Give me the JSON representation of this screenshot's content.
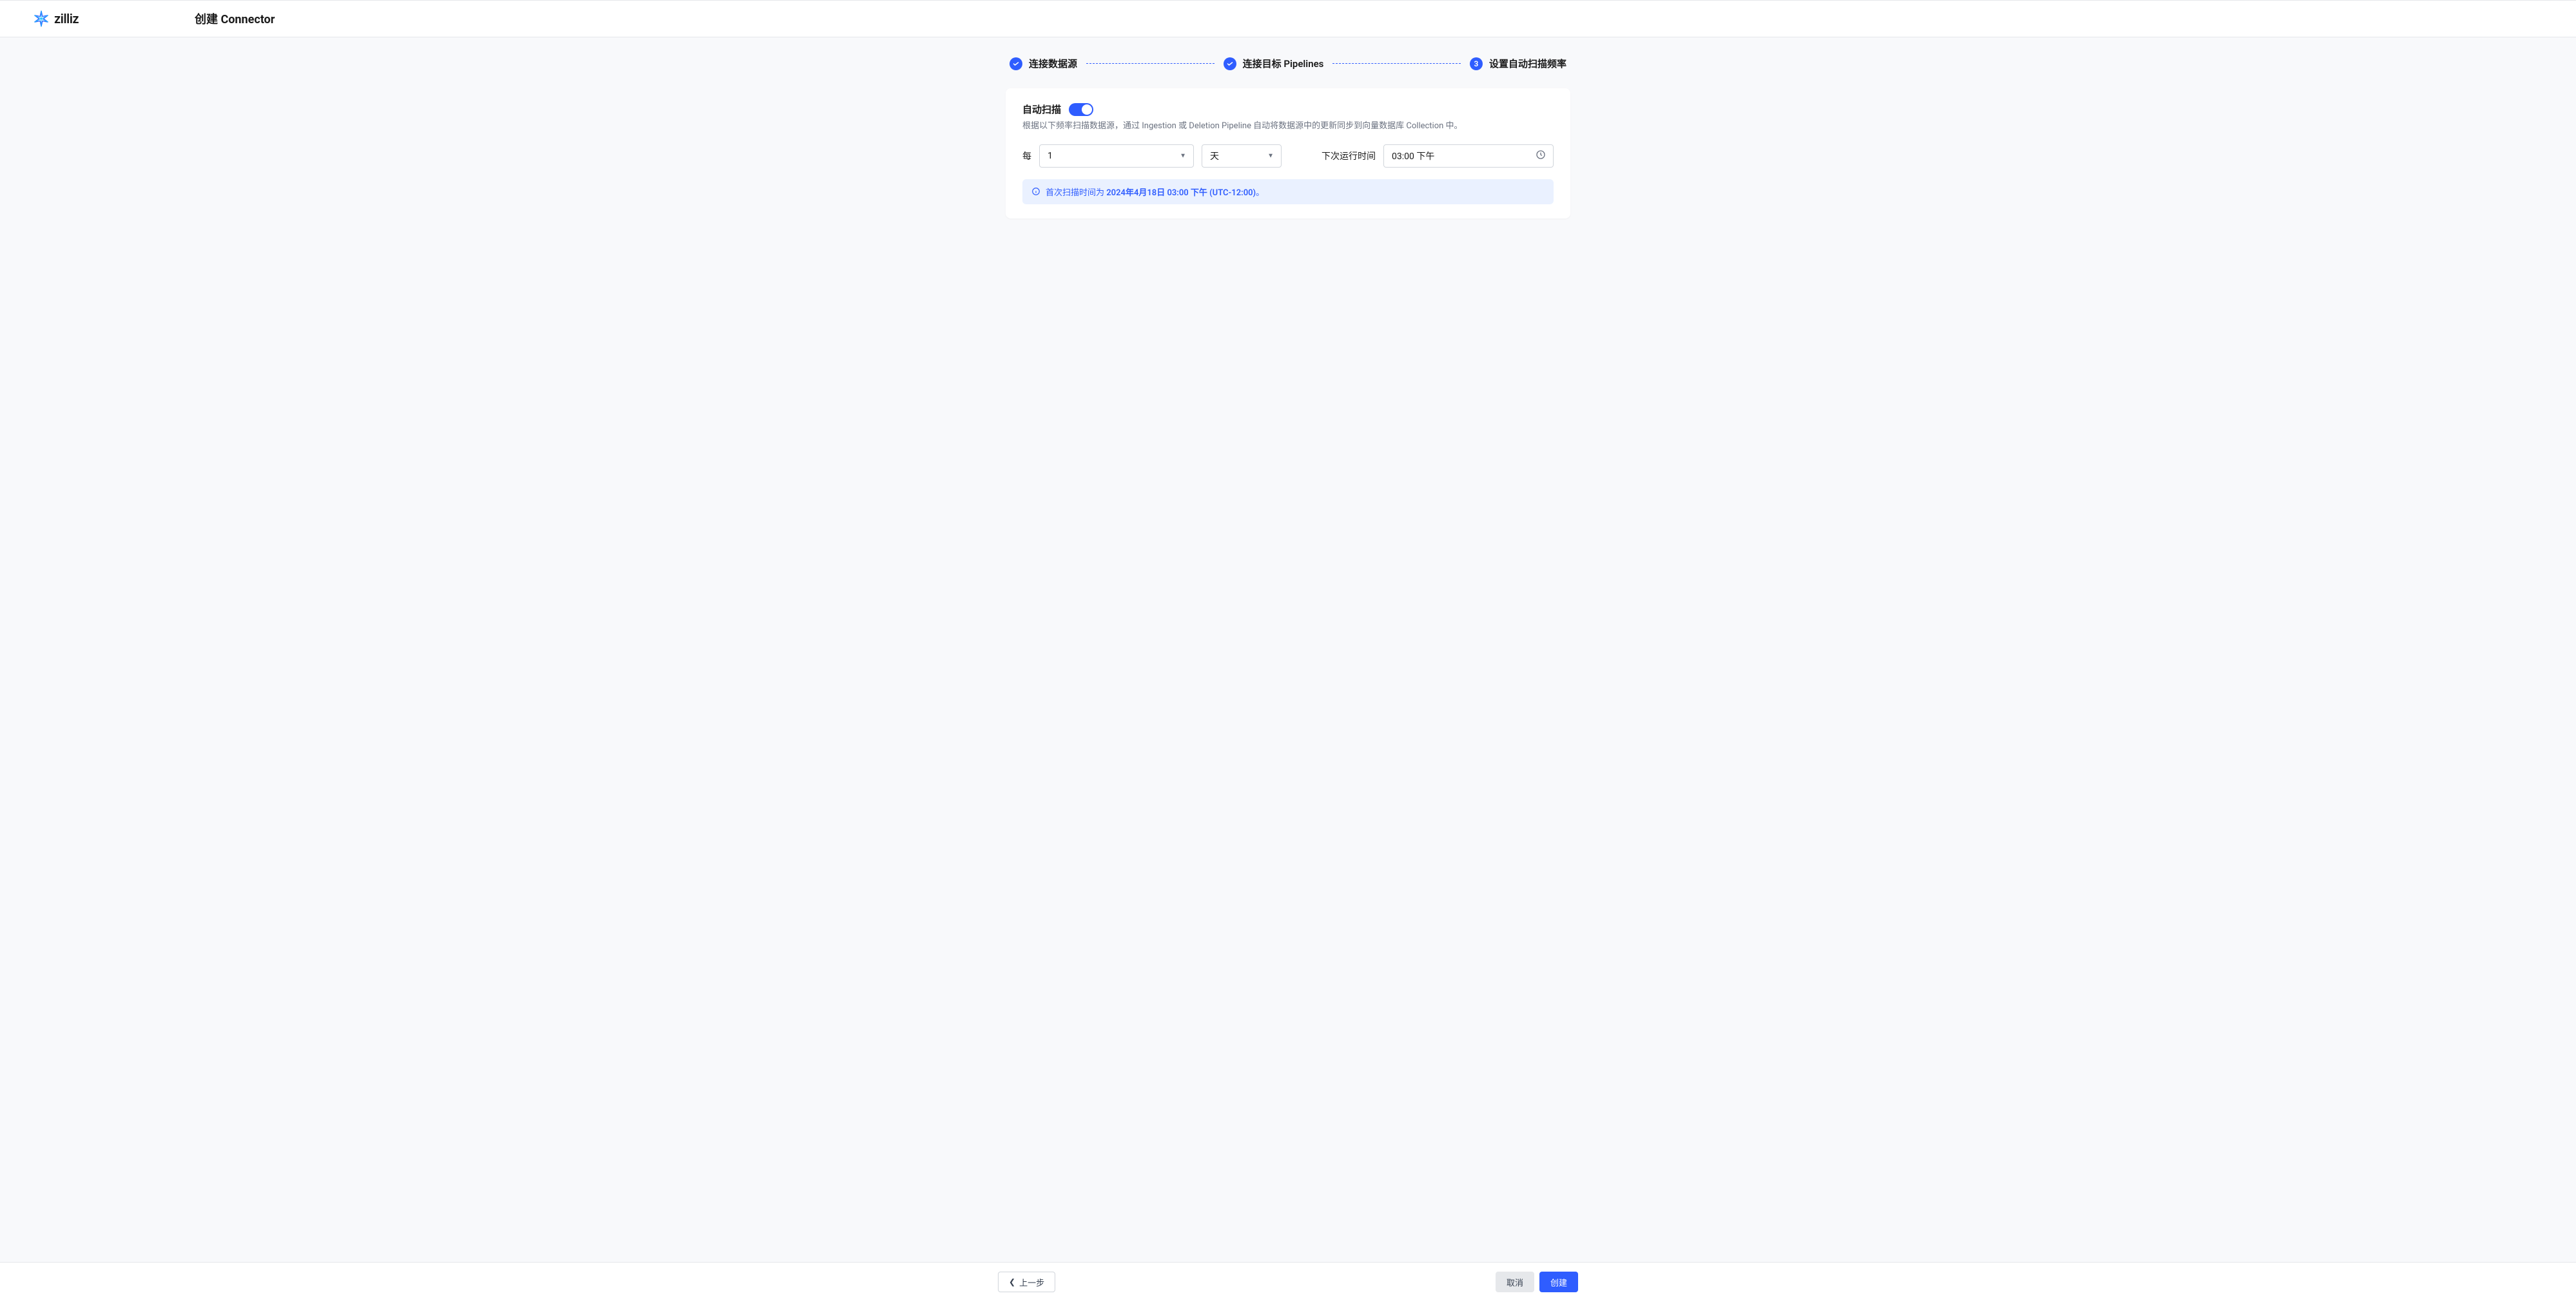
{
  "brand": {
    "name": "zilliz"
  },
  "header": {
    "page_title": "创建 Connector"
  },
  "stepper": {
    "steps": [
      {
        "label": "连接数据源",
        "state": "done"
      },
      {
        "label": "连接目标 Pipelines",
        "state": "done"
      },
      {
        "label": "设置自动扫描频率",
        "state": "current",
        "number": "3"
      }
    ]
  },
  "auto_scan": {
    "title": "自动扫描",
    "enabled": true,
    "description": "根据以下频率扫描数据源，通过 Ingestion 或 Deletion Pipeline 自动将数据源中的更新同步到向量数据库 Collection 中。",
    "freq_prefix": "每",
    "interval_value": "1",
    "unit_value": "天",
    "next_run_label": "下次运行时间",
    "next_run_value": "03:00 下午",
    "info_prefix": "首次扫描时间为 ",
    "info_time": "2024年4月18日 03:00 下午 (UTC-12:00)",
    "info_suffix": "。"
  },
  "footer": {
    "prev": "上一步",
    "cancel": "取消",
    "create": "创建"
  }
}
